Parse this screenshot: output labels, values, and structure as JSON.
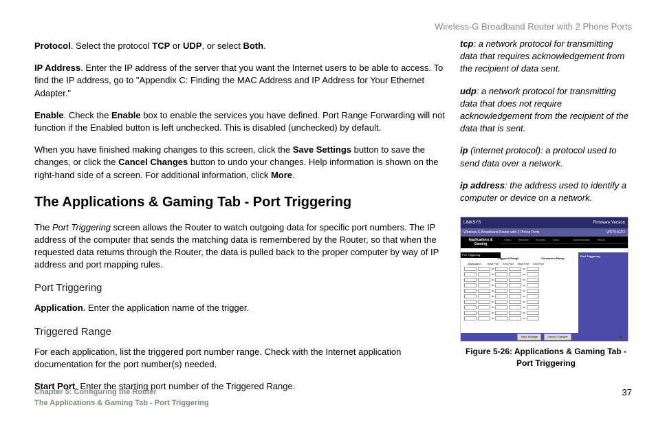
{
  "header": {
    "product": "Wireless-G Broadband Router with 2 Phone Ports"
  },
  "main": {
    "paragraphs": {
      "p1_pre": "Protocol",
      "p1_mid1": ". Select the protocol ",
      "p1_b1": "TCP",
      "p1_mid2": " or ",
      "p1_b2": "UDP",
      "p1_mid3": ", or select ",
      "p1_b3": "Both",
      "p1_end": ".",
      "p2_pre": "IP Address",
      "p2_body": ". Enter the IP address of the server that you want the Internet users to be able to access. To find the IP address, go to \"Appendix C: Finding the MAC Address and IP Address for Your Ethernet Adapter.\"",
      "p3_pre": "Enable",
      "p3_mid1": ". Check the ",
      "p3_b1": "Enable",
      "p3_body": " box to enable the services you have defined. Port Range Forwarding will not function if the Enabled button is left unchecked. This is disabled (unchecked) by default.",
      "p4_pre": "When you have finished making changes to this screen, click the ",
      "p4_b1": "Save Settings",
      "p4_mid": " button to save the changes, or click the ",
      "p4_b2": "Cancel Changes",
      "p4_mid2": " button to undo your changes. Help information is shown on the right-hand side of a screen. For additional information, click ",
      "p4_b3": "More",
      "p4_end": "."
    },
    "heading": "The Applications & Gaming Tab - Port Triggering",
    "intro_pre": "The ",
    "intro_i": "Port Triggering",
    "intro_body": " screen allows the Router to watch outgoing data for specific port numbers. The IP address of the computer that sends the matching data is remembered by the Router, so that when the requested data returns through the Router, the data is pulled back to the proper computer by way of IP address and port mapping rules.",
    "sub1": "Port Triggering",
    "app_pre": "Application",
    "app_body": ". Enter the application name of the trigger.",
    "sub2": "Triggered Range",
    "trig_body": "For each application, list the triggered port number range. Check with the Internet application documentation for the port number(s) needed.",
    "start_pre": "Start Port",
    "start_body": ". Enter the starting port number of the Triggered Range."
  },
  "sidebar": {
    "defs": {
      "tcp_term": "tcp",
      "tcp_body": ": a network protocol for transmitting data that requires acknowledgement from the recipient of data sent.",
      "udp_term": "udp",
      "udp_body": ": a network protocol for transmitting data that does not require acknowledgement from the recipient of the data that is sent.",
      "ip_term": "ip",
      "ip_body": " (internet protocol): a protocol used to send data over a network.",
      "ipa_term": "ip address",
      "ipa_body": ": the address used to identify a computer or device on a network."
    }
  },
  "figure": {
    "brand": "LINKSYS",
    "fw": "Firmware Version",
    "title": "Wireless-G Broadband Router with 2 Phone Ports",
    "model": "WRT54GP2",
    "main_tab": "Applications & Gaming",
    "tabs": [
      "Setup",
      "Wireless",
      "Security",
      "Voice",
      "",
      "Administration",
      "Status"
    ],
    "subtab": "Port Triggering",
    "section": "Port Triggering",
    "col1": "Triggered Range",
    "col2": "Forwarded Range",
    "colh_app": "Application",
    "colh_sp": "Start Port",
    "colh_ep": "End Port",
    "help_title": "Port Triggering",
    "btn_save": "Save Settings",
    "btn_cancel": "Cancel Changes",
    "caption": "Figure 5-26: Applications & Gaming Tab - Port Triggering"
  },
  "footer": {
    "chapter": "Chapter 5: Configuring the Router",
    "section": "The Applications & Gaming Tab - Port Triggering",
    "page": "37"
  }
}
